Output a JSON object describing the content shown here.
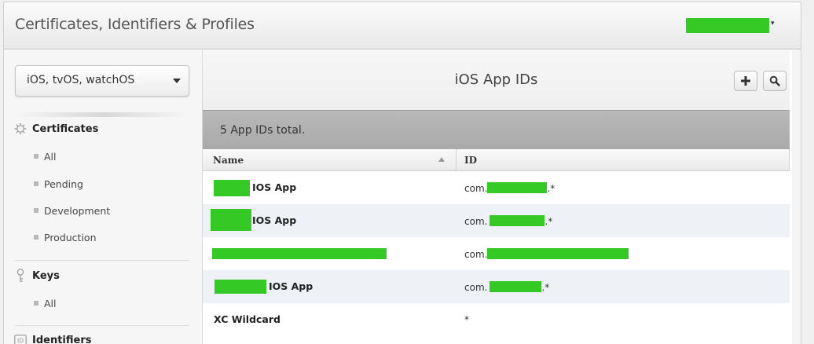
{
  "app": {
    "title": "Certificates, Identifiers & Profiles",
    "account_caret": "▾"
  },
  "sidebar": {
    "platform": "iOS, tvOS, watchOS",
    "sections": [
      {
        "label": "Certificates",
        "icon": "gear-icon",
        "items": [
          "All",
          "Pending",
          "Development",
          "Production"
        ]
      },
      {
        "label": "Keys",
        "icon": "key-icon",
        "items": [
          "All"
        ]
      },
      {
        "label": "Identifiers",
        "icon": "id-icon",
        "items": []
      }
    ]
  },
  "main": {
    "title": "iOS App IDs",
    "summary": "5  App IDs total.",
    "table": {
      "headers": {
        "name": "Name",
        "id": "ID"
      },
      "rows": [
        {
          "name": "IOS App",
          "id_prefix": "com.",
          "id_suffix": ".*"
        },
        {
          "name": "IOS App",
          "id_prefix": "com.",
          "id_suffix": ".*"
        },
        {
          "name": "",
          "id_prefix": "com.",
          "id_suffix": ""
        },
        {
          "name": "IOS App",
          "id_prefix": "com.",
          "id_suffix": ".*"
        },
        {
          "name": "XC Wildcard",
          "id_prefix": "*",
          "id_suffix": ""
        }
      ]
    }
  },
  "colors": {
    "redaction": "#34c924"
  }
}
